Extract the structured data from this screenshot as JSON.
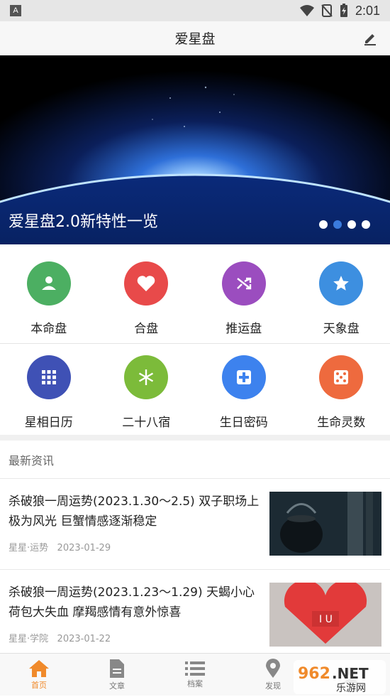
{
  "status_bar": {
    "time": "2:01"
  },
  "header": {
    "title": "爱星盘"
  },
  "banner": {
    "caption": "爱星盘2.0新特性一览",
    "active_dot": 1,
    "dot_count": 4
  },
  "grid": [
    {
      "label": "本命盘",
      "icon": "person-icon",
      "color": "#4caf62"
    },
    {
      "label": "合盘",
      "icon": "heart-icon",
      "color": "#e84a4a"
    },
    {
      "label": "推运盘",
      "icon": "shuffle-icon",
      "color": "#9b4dbf"
    },
    {
      "label": "天象盘",
      "icon": "star-icon",
      "color": "#3d8fe0"
    },
    {
      "label": "星相日历",
      "icon": "grid-icon",
      "color": "#3f51b5"
    },
    {
      "label": "二十八宿",
      "icon": "snowflake-icon",
      "color": "#7cbb3a"
    },
    {
      "label": "生日密码",
      "icon": "plus-box-icon",
      "color": "#3d82ee"
    },
    {
      "label": "生命灵数",
      "icon": "dice-icon",
      "color": "#ee6a3e"
    }
  ],
  "news": {
    "section_title": "最新资讯",
    "items": [
      {
        "title": "杀破狼一周运势(2023.1.30～2.5) 双子职场上极为风光 巨蟹情感逐渐稳定",
        "source": "星星·运势",
        "date": "2023-01-29"
      },
      {
        "title": "杀破狼一周运势(2023.1.23～1.29) 天蝎小心荷包大失血 摩羯感情有意外惊喜",
        "source": "星星·学院",
        "date": "2023-01-22"
      }
    ]
  },
  "tabs": [
    {
      "label": "首页",
      "icon": "home-icon",
      "active": true
    },
    {
      "label": "文章",
      "icon": "document-icon",
      "active": false
    },
    {
      "label": "档案",
      "icon": "list-icon",
      "active": false
    },
    {
      "label": "发现",
      "icon": "location-pin-icon",
      "active": false
    }
  ],
  "watermark": {
    "text": "962.NET",
    "subtext": "乐游网"
  },
  "colors": {
    "accent": "#f08a2b",
    "dot_active": "#3a7bdd"
  }
}
